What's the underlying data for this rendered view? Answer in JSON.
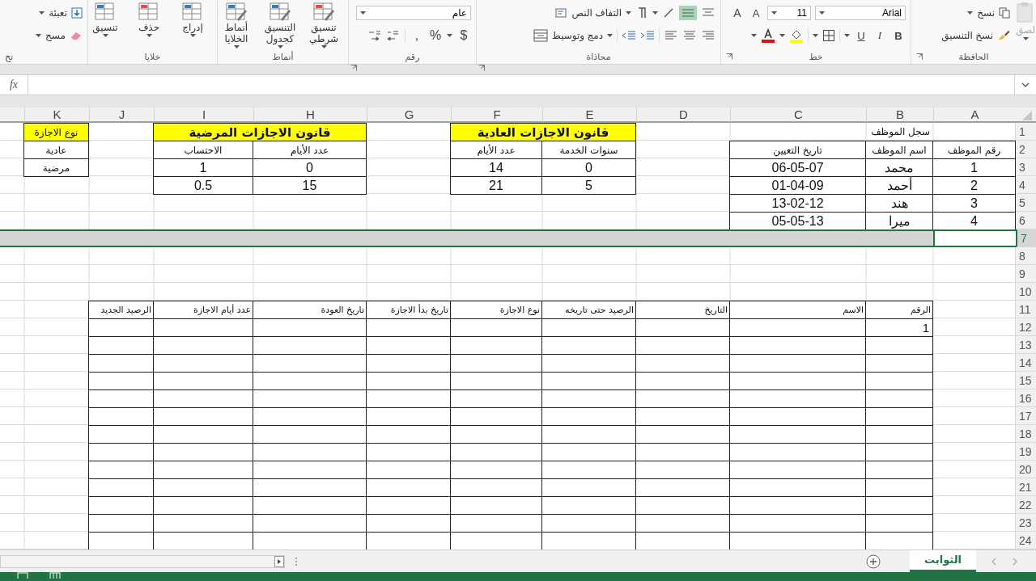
{
  "ribbon": {
    "groups": [
      {
        "kind": "clipboard",
        "label": "الحافظة",
        "paste": "لصق",
        "copy": "نسخ",
        "format_painter": "نسخ التنسيق"
      },
      {
        "kind": "font",
        "label": "خط",
        "font_name": "Arial",
        "font_size": "11",
        "grow_font": "A",
        "shrink_font": "A",
        "bold": "B",
        "italic": "I",
        "underline": "U"
      },
      {
        "kind": "alignment",
        "label": "محاذاة",
        "wrap_text": "التفاف النص",
        "merge_center": "دمج وتوسيط"
      },
      {
        "kind": "number",
        "label": "رقم",
        "format": "عام",
        "currency": "$",
        "percent": "%",
        "comma": ","
      },
      {
        "kind": "styles",
        "label": "أنماط",
        "buttons": [
          "تنسيق شرطي",
          "التنسيق كجدول",
          "أنماط الخلايا"
        ]
      },
      {
        "kind": "cells",
        "label": "خلايا",
        "buttons": [
          "إدراج",
          "حذف",
          "تنسيق"
        ]
      },
      {
        "kind": "editing",
        "label": "تح",
        "fill": "تعبئة",
        "clear": "مسح"
      }
    ]
  },
  "formula_bar": {
    "fx": "fx"
  },
  "sheet": {
    "columns": [
      "A",
      "B",
      "C",
      "D",
      "E",
      "F",
      "G",
      "H",
      "I",
      "J",
      "K"
    ],
    "rows": [
      {
        "number": "1",
        "selected": false
      },
      {
        "number": "2",
        "selected": false
      },
      {
        "number": "3",
        "selected": false
      },
      {
        "number": "4",
        "selected": false
      },
      {
        "number": "5",
        "selected": false
      },
      {
        "number": "6",
        "selected": false
      },
      {
        "number": "7",
        "selected": true
      },
      {
        "number": "8",
        "selected": false
      },
      {
        "number": "9",
        "selected": false
      },
      {
        "number": "10",
        "selected": false
      },
      {
        "number": "11",
        "selected": false
      },
      {
        "number": "12",
        "selected": false
      },
      {
        "number": "13",
        "selected": false
      },
      {
        "number": "14",
        "selected": false
      },
      {
        "number": "15",
        "selected": false
      },
      {
        "number": "16",
        "selected": false
      },
      {
        "number": "17",
        "selected": false
      },
      {
        "number": "18",
        "selected": false
      },
      {
        "number": "19",
        "selected": false
      },
      {
        "number": "20",
        "selected": false
      },
      {
        "number": "21",
        "selected": false
      },
      {
        "number": "22",
        "selected": false
      },
      {
        "number": "23",
        "selected": false
      },
      {
        "number": "24",
        "selected": false
      }
    ],
    "employee_register": {
      "title": "سجل الموظف",
      "headers": [
        "رقم الموظف",
        "اسم الموظف",
        "تاريخ التعيين"
      ],
      "rows": [
        [
          "1",
          "محمد",
          "06-05-07"
        ],
        [
          "2",
          "أحمد",
          "01-04-09"
        ],
        [
          "3",
          "هند",
          "13-02-12"
        ],
        [
          "4",
          "ميرا",
          "05-05-13"
        ]
      ]
    },
    "regular_leave": {
      "title": "قانون الاجازات العادية",
      "headers": [
        "سنوات الخدمة",
        "عدد الأيام"
      ],
      "rows": [
        [
          "0",
          "14"
        ],
        [
          "5",
          "21"
        ]
      ]
    },
    "sick_leave": {
      "title": "قانون الاجازات المرضية",
      "headers": [
        "عدد الأيام",
        "الاحتساب"
      ],
      "rows": [
        [
          "0",
          "1"
        ],
        [
          "15",
          "0.5"
        ]
      ]
    },
    "leave_types": {
      "title": "نوع الاجازة",
      "items": [
        "عادية",
        "مرضية"
      ]
    },
    "ledger": {
      "headers": [
        "الرقم",
        "الاسم",
        "التاريخ",
        "الرصيد حتى تاريخه",
        "نوع الاجازة",
        "تاريخ بدأ الاجازة",
        "تاريخ العودة",
        "عدد أيام الاجازة",
        "الرصيد الجديد"
      ],
      "rows": [
        [
          "1"
        ]
      ]
    }
  },
  "sheet_tabs": [
    {
      "label": "الثوابت",
      "selected": true
    }
  ]
}
